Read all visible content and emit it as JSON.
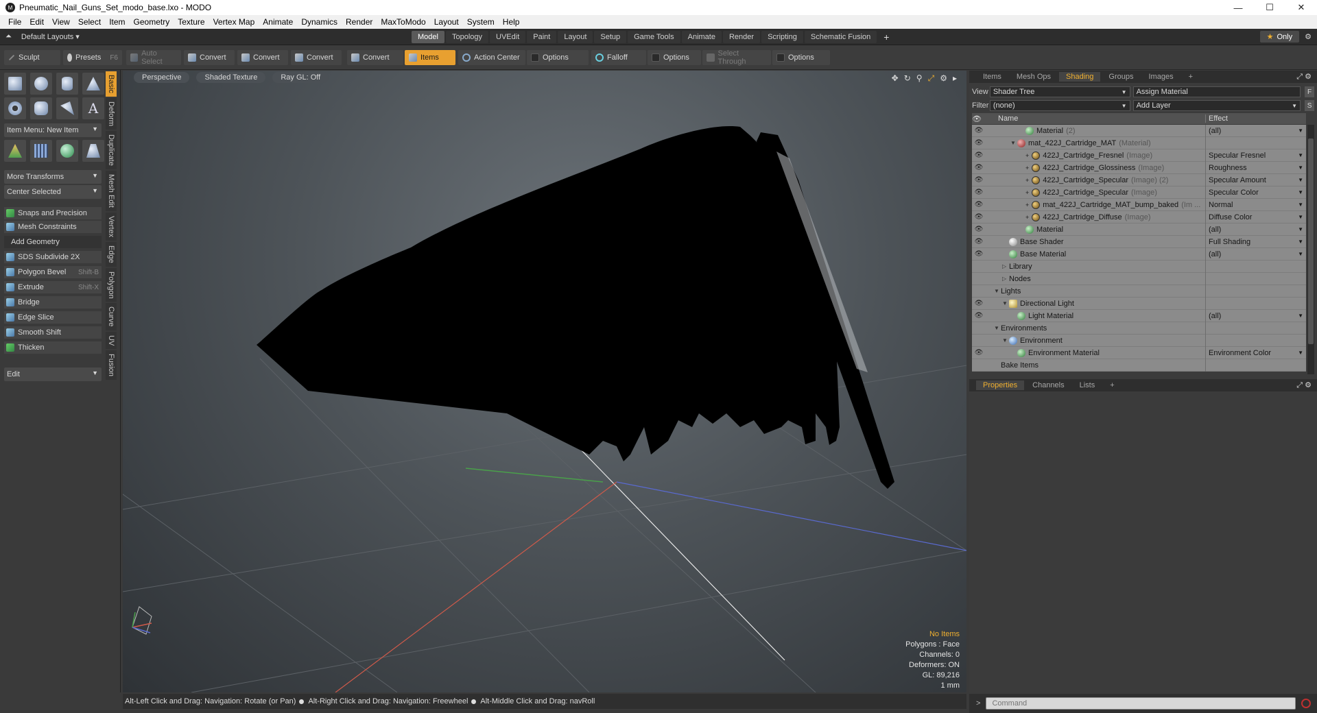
{
  "window": {
    "title": "Pneumatic_Nail_Guns_Set_modo_base.lxo - MODO",
    "minimize": "—",
    "maximize": "☐",
    "close": "✕"
  },
  "menubar": [
    "File",
    "Edit",
    "View",
    "Select",
    "Item",
    "Geometry",
    "Texture",
    "Vertex Map",
    "Animate",
    "Dynamics",
    "Render",
    "MaxToModo",
    "Layout",
    "System",
    "Help"
  ],
  "layoutbar": {
    "layouts_label": "Default Layouts ▾",
    "tabs": [
      "Model",
      "Topology",
      "UVEdit",
      "Paint",
      "Layout",
      "Setup",
      "Game Tools",
      "Animate",
      "Render",
      "Scripting",
      "Schematic Fusion"
    ],
    "active_tab": "Model",
    "plus": "+",
    "only_label": "Only"
  },
  "toolbar": {
    "sculpt": "Sculpt",
    "presets": "Presets",
    "presets_key": "F6",
    "auto_select": "Auto Select",
    "convert1": "Convert",
    "convert2": "Convert",
    "convert3": "Convert",
    "convert4": "Convert",
    "items": "Items",
    "action_center": "Action Center",
    "options1": "Options",
    "falloff": "Falloff",
    "options2": "Options",
    "select_through": "Select Through",
    "options3": "Options"
  },
  "left_panel": {
    "item_menu": "Item Menu: New Item",
    "more_transforms": "More Transforms",
    "center_selected": "Center Selected",
    "snaps": "Snaps and Precision",
    "mesh_constraints": "Mesh Constraints",
    "add_geometry": "Add Geometry",
    "tools": [
      {
        "label": "SDS Subdivide 2X",
        "key": ""
      },
      {
        "label": "Polygon Bevel",
        "key": "Shift-B"
      },
      {
        "label": "Extrude",
        "key": "Shift-X"
      },
      {
        "label": "Bridge",
        "key": ""
      },
      {
        "label": "Edge Slice",
        "key": ""
      },
      {
        "label": "Smooth Shift",
        "key": ""
      },
      {
        "label": "Thicken",
        "key": ""
      }
    ],
    "edit": "Edit",
    "vtabs": [
      "Basic",
      "Deform",
      "Duplicate",
      "Mesh Edit",
      "Vertex",
      "Edge",
      "Polygon",
      "Curve",
      "UV",
      "Fusion"
    ]
  },
  "viewport": {
    "perspective": "Perspective",
    "shading": "Shaded Texture",
    "raygl": "Ray GL: Off",
    "stats": {
      "no_items": "No Items",
      "polygons": "Polygons : Face",
      "channels": "Channels: 0",
      "deformers": "Deformers: ON",
      "gl": "GL: 89,216",
      "unit": "1 mm"
    }
  },
  "statusbar": {
    "hint1": "Alt-Left Click and Drag: Navigation: Rotate (or Pan)",
    "hint2": "Alt-Right Click and Drag: Navigation: Freewheel",
    "hint3": "Alt-Middle Click and Drag: navRoll"
  },
  "right_panel": {
    "tabs": [
      "Items",
      "Mesh Ops",
      "Shading",
      "Groups",
      "Images"
    ],
    "active_tab": "Shading",
    "view_label": "View",
    "view_value": "Shader Tree",
    "assign_material": "Assign Material",
    "filter_label": "Filter",
    "filter_value": "(none)",
    "add_layer": "Add Layer",
    "col_name": "Name",
    "col_effect": "Effect",
    "rows": [
      {
        "indent": 3,
        "icon": "material",
        "name": "Material",
        "sub": "(2)",
        "effect": "(all)",
        "eye": true,
        "tw": ""
      },
      {
        "indent": 2,
        "icon": "mat-red",
        "name": "mat_422J_Cartridge_MAT",
        "sub": "(Material)",
        "effect": "",
        "eye": true,
        "tw": "▼"
      },
      {
        "indent": 3,
        "icon": "image",
        "name": "422J_Cartridge_Fresnel",
        "sub": "(Image)",
        "effect": "Specular Fresnel",
        "eye": true,
        "tw": "",
        "plus": true
      },
      {
        "indent": 3,
        "icon": "image",
        "name": "422J_Cartridge_Glossiness",
        "sub": "(Image)",
        "effect": "Roughness",
        "eye": true,
        "tw": "",
        "plus": true
      },
      {
        "indent": 3,
        "icon": "image",
        "name": "422J_Cartridge_Specular",
        "sub": "(Image) (2)",
        "effect": "Specular Amount",
        "eye": true,
        "tw": "",
        "plus": true
      },
      {
        "indent": 3,
        "icon": "image",
        "name": "422J_Cartridge_Specular",
        "sub": "(Image)",
        "effect": "Specular Color",
        "eye": true,
        "tw": "",
        "plus": true
      },
      {
        "indent": 3,
        "icon": "image",
        "name": "mat_422J_Cartridge_MAT_bump_baked",
        "sub": "(Im ...",
        "effect": "Normal",
        "eye": true,
        "tw": "",
        "plus": true
      },
      {
        "indent": 3,
        "icon": "image",
        "name": "422J_Cartridge_Diffuse",
        "sub": "(Image)",
        "effect": "Diffuse Color",
        "eye": true,
        "tw": "",
        "plus": true
      },
      {
        "indent": 3,
        "icon": "material",
        "name": "Material",
        "sub": "",
        "effect": "(all)",
        "eye": true,
        "tw": ""
      },
      {
        "indent": 1,
        "icon": "gray",
        "name": "Base Shader",
        "sub": "",
        "effect": "Full Shading",
        "eye": true,
        "tw": ""
      },
      {
        "indent": 1,
        "icon": "material",
        "name": "Base Material",
        "sub": "",
        "effect": "(all)",
        "eye": true,
        "tw": ""
      },
      {
        "indent": 1,
        "icon": "",
        "name": "Library",
        "sub": "",
        "effect": "",
        "eye": false,
        "tw": "▷"
      },
      {
        "indent": 1,
        "icon": "",
        "name": "Nodes",
        "sub": "",
        "effect": "",
        "eye": false,
        "tw": "▷"
      },
      {
        "indent": 0,
        "icon": "",
        "name": "Lights",
        "sub": "",
        "effect": "",
        "eye": false,
        "tw": "▼"
      },
      {
        "indent": 1,
        "icon": "light",
        "name": "Directional Light",
        "sub": "",
        "effect": "",
        "eye": true,
        "tw": "▼"
      },
      {
        "indent": 2,
        "icon": "material",
        "name": "Light Material",
        "sub": "",
        "effect": "(all)",
        "eye": true,
        "tw": ""
      },
      {
        "indent": 0,
        "icon": "",
        "name": "Environments",
        "sub": "",
        "effect": "",
        "eye": false,
        "tw": "▼"
      },
      {
        "indent": 1,
        "icon": "env",
        "name": "Environment",
        "sub": "",
        "effect": "",
        "eye": false,
        "tw": "▼"
      },
      {
        "indent": 2,
        "icon": "material",
        "name": "Environment Material",
        "sub": "",
        "effect": "Environment Color",
        "eye": true,
        "tw": ""
      },
      {
        "indent": 0,
        "icon": "",
        "name": "Bake Items",
        "sub": "",
        "effect": "",
        "eye": false,
        "tw": ""
      }
    ],
    "props_tabs": [
      "Properties",
      "Channels",
      "Lists"
    ],
    "props_active": "Properties",
    "command_placeholder": "Command"
  }
}
